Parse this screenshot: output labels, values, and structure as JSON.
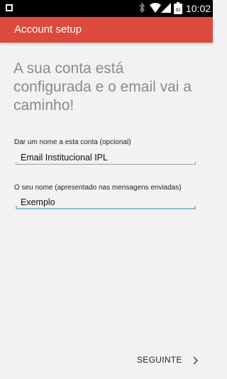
{
  "status_bar": {
    "time": "10:02",
    "icons": [
      "square-icon",
      "bluetooth-icon",
      "wifi-icon",
      "signal-icon",
      "battery-icon"
    ]
  },
  "app_bar": {
    "title": "Account setup",
    "color": "#db4a3c"
  },
  "headline": "A sua conta está configurada e o email vai a caminho!",
  "fields": [
    {
      "label": "Dar um nome a esta conta (opcional)",
      "value": "Email Institucional IPL"
    },
    {
      "label": "O seu nome (apresentado nas mensagens enviadas)",
      "value": "Exemplo"
    }
  ],
  "actions": {
    "next_label": "SEGUINTE",
    "next_icon": "chevron-right-icon"
  },
  "colors": {
    "accent_focus": "#79c5d9",
    "background": "#f2f2f2"
  }
}
